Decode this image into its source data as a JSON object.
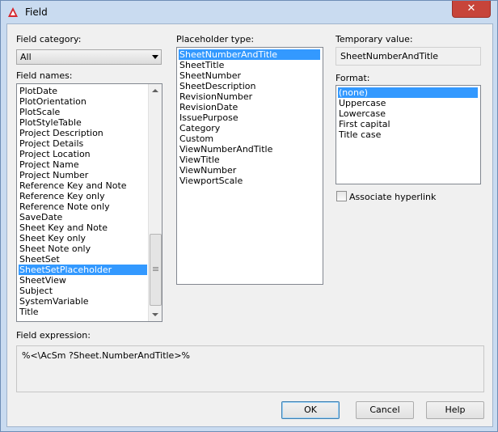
{
  "window": {
    "title": "Field"
  },
  "labels": {
    "field_category": "Field category:",
    "field_names": "Field names:",
    "placeholder_type": "Placeholder type:",
    "temporary_value": "Temporary value:",
    "format": "Format:",
    "associate_hyperlink": "Associate hyperlink",
    "field_expression": "Field expression:"
  },
  "category": {
    "selected": "All"
  },
  "field_names": {
    "items": [
      "PlotDate",
      "PlotOrientation",
      "PlotScale",
      "PlotStyleTable",
      "Project Description",
      "Project Details",
      "Project Location",
      "Project Name",
      "Project Number",
      "Reference Key and Note",
      "Reference Key only",
      "Reference Note only",
      "SaveDate",
      "Sheet Key and Note",
      "Sheet Key only",
      "Sheet Note only",
      "SheetSet",
      "SheetSetPlaceholder",
      "SheetView",
      "Subject",
      "SystemVariable",
      "Title"
    ],
    "selected": "SheetSetPlaceholder"
  },
  "placeholder_types": {
    "items": [
      "SheetNumberAndTitle",
      "SheetTitle",
      "SheetNumber",
      "SheetDescription",
      "RevisionNumber",
      "RevisionDate",
      "IssuePurpose",
      "Category",
      "Custom",
      "ViewNumberAndTitle",
      "ViewTitle",
      "ViewNumber",
      "ViewportScale"
    ],
    "selected": "SheetNumberAndTitle"
  },
  "temporary_value": "SheetNumberAndTitle",
  "format": {
    "items": [
      "(none)",
      "Uppercase",
      "Lowercase",
      "First capital",
      "Title case"
    ],
    "selected": "(none)"
  },
  "associate_hyperlink_checked": false,
  "field_expression": "%<\\AcSm ?Sheet.NumberAndTitle>%",
  "buttons": {
    "ok": "OK",
    "cancel": "Cancel",
    "help": "Help"
  },
  "colors": {
    "selection": "#3399ff",
    "close_button": "#c7443a",
    "title_bar": "#c9dbf0"
  }
}
